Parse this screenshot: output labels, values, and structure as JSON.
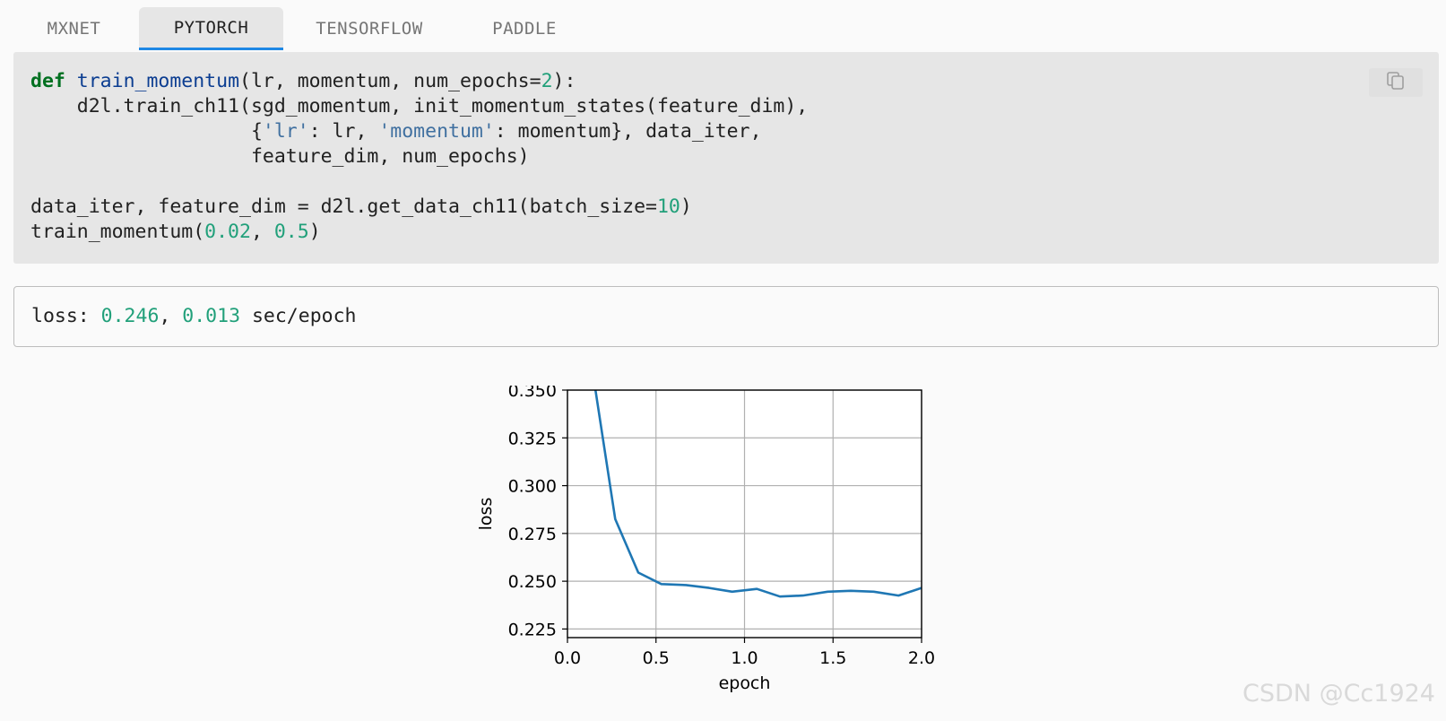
{
  "tabs": [
    {
      "label": "MXNET"
    },
    {
      "label": "PYTORCH",
      "active": true
    },
    {
      "label": "TENSORFLOW"
    },
    {
      "label": "PADDLE"
    }
  ],
  "code": {
    "lines": [
      [
        {
          "t": "def",
          "c": "kw"
        },
        {
          "t": " "
        },
        {
          "t": "train_momentum",
          "c": "fn"
        },
        {
          "t": "(lr, momentum, num_epochs="
        },
        {
          "t": "2",
          "c": "num"
        },
        {
          "t": "):"
        }
      ],
      [
        {
          "t": "    d2l.train_ch11(sgd_momentum, init_momentum_states(feature_dim),"
        }
      ],
      [
        {
          "t": "                   {"
        },
        {
          "t": "'lr'",
          "c": "str"
        },
        {
          "t": ": lr, "
        },
        {
          "t": "'momentum'",
          "c": "str"
        },
        {
          "t": ": momentum}, data_iter,"
        }
      ],
      [
        {
          "t": "                   feature_dim, num_epochs)"
        }
      ],
      [
        {
          "t": ""
        }
      ],
      [
        {
          "t": "data_iter, feature_dim = d2l.get_data_ch11(batch_size="
        },
        {
          "t": "10",
          "c": "num"
        },
        {
          "t": ")"
        }
      ],
      [
        {
          "t": "train_momentum("
        },
        {
          "t": "0.02",
          "c": "num"
        },
        {
          "t": ", "
        },
        {
          "t": "0.5",
          "c": "num"
        },
        {
          "t": ")"
        }
      ]
    ],
    "copy_icon": "copy-icon"
  },
  "output": {
    "prefix": "loss: ",
    "loss": "0.246",
    "sep": ", ",
    "time": "0.013",
    "suffix": " sec/epoch"
  },
  "chart_data": {
    "type": "line",
    "xlabel": "epoch",
    "ylabel": "loss",
    "xlim": [
      0.0,
      2.0
    ],
    "ylim": [
      0.2205,
      0.35
    ],
    "xticks": [
      "0.0",
      "0.5",
      "1.0",
      "1.5",
      "2.0"
    ],
    "xtick_values": [
      0.0,
      0.5,
      1.0,
      1.5,
      2.0
    ],
    "yticks": [
      "0.225",
      "0.250",
      "0.275",
      "0.300",
      "0.325",
      "0.350"
    ],
    "ytick_values": [
      0.225,
      0.25,
      0.275,
      0.3,
      0.325,
      0.35
    ],
    "grid": true,
    "series": [
      {
        "color": "#1f77b4",
        "x": [
          0.13,
          0.27,
          0.4,
          0.53,
          0.67,
          0.8,
          0.93,
          1.07,
          1.2,
          1.33,
          1.47,
          1.6,
          1.73,
          1.87,
          2.0
        ],
        "y": [
          0.367,
          0.2825,
          0.2545,
          0.2485,
          0.248,
          0.2465,
          0.2445,
          0.246,
          0.242,
          0.2425,
          0.2445,
          0.245,
          0.2445,
          0.2425,
          0.2465
        ]
      }
    ]
  },
  "watermark": "CSDN @Cc1924"
}
